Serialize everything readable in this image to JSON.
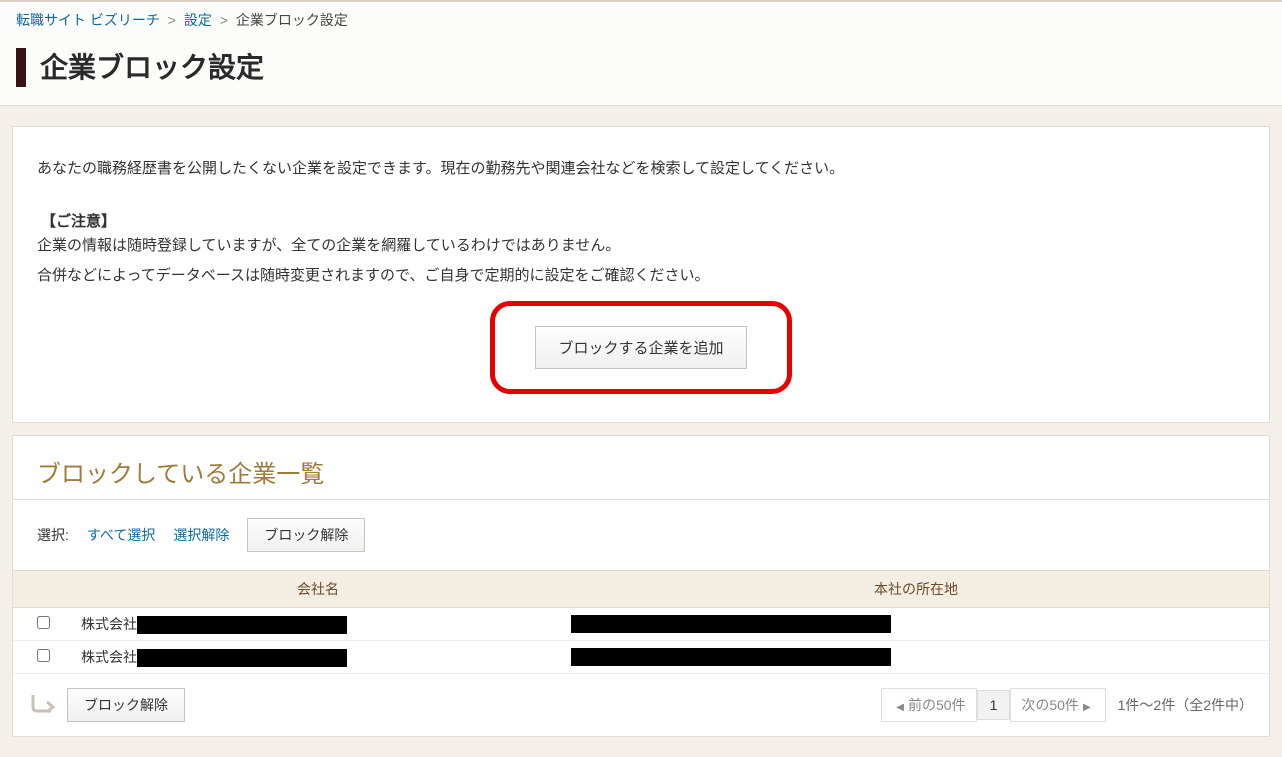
{
  "breadcrumb": {
    "home": "転職サイト ビズリーチ",
    "settings": "設定",
    "current": "企業ブロック設定"
  },
  "page_title": "企業ブロック設定",
  "intro": "あなたの職務経歴書を公開したくない企業を設定できます。現在の勤務先や関連会社などを検索して設定してください。",
  "caution_title": "【ご注意】",
  "caution_line1": "企業の情報は随時登録していますが、全ての企業を網羅しているわけではありません。",
  "caution_line2": "合併などによってデータベースは随時変更されますので、ご自身で定期的に設定をご確認ください。",
  "add_block_button": "ブロックする企業を追加",
  "list_heading": "ブロックしている企業一覧",
  "toolbar": {
    "select_label": "選択:",
    "select_all": "すべて選択",
    "deselect": "選択解除",
    "unblock": "ブロック解除"
  },
  "table": {
    "col_name": "会社名",
    "col_location": "本社の所在地",
    "rows": [
      {
        "name_prefix": "株式会社",
        "name_redacted_width": 210,
        "location_redacted_width": 320
      },
      {
        "name_prefix": "株式会社",
        "name_redacted_width": 210,
        "location_redacted_width": 320
      }
    ]
  },
  "footer": {
    "unblock": "ブロック解除",
    "prev": "前の50件",
    "page": "1",
    "next": "次の50件",
    "count": "1件～2件（全2件中）"
  }
}
